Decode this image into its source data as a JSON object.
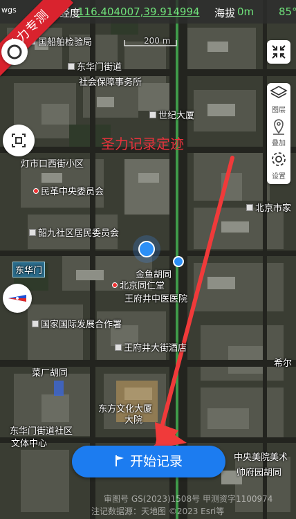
{
  "status": {
    "crs_label": "wgs",
    "coord_label": "经度",
    "coord_value": "116.404007,39.914994",
    "altitude_label": "海拔",
    "altitude_value": "0m",
    "temperature_value": "85°"
  },
  "ribbon": {
    "label": "圣力专测"
  },
  "watermark": {
    "text": "圣力记录定迹"
  },
  "scale": {
    "label": "200 m"
  },
  "toolbar": {
    "layers_label": "图层",
    "overlay_label": "叠加",
    "settings_label": "设置"
  },
  "icons": {
    "locate": "locate-icon",
    "fullscreen": "collapse-icon",
    "layers": "layers-icon",
    "overlay": "overlay-pin-icon",
    "settings": "gear-icon",
    "scan": "scan-icon",
    "compass": "compass-icon",
    "flag": "flag-icon"
  },
  "poi": {
    "p1": "国船舶检验局",
    "p2": "东华门街道",
    "p3": "社会保障事务所",
    "p4": "世纪大厦",
    "p5": "灯市口西街小区",
    "p6": "民革中央委员会",
    "p7": "北京市家",
    "p8": "韶九社区居民委员会",
    "p9": "东华门",
    "p10": "金鱼胡同",
    "p11": "北京同仁堂",
    "p12": "王府井中医医院",
    "p13": "国家国际发展合作署",
    "p14": "王府井大街酒店",
    "p15": "菜厂胡同",
    "p16": "东方文化大厦",
    "p17": "大院",
    "p18": "东华门街道社区",
    "p19": "文体中心",
    "p20": "中央美院美术",
    "p21": "帅府园胡同",
    "p22": "希尔"
  },
  "actions": {
    "start_record_label": "开始记录"
  },
  "attribution": {
    "line1": "审图号 GS(2023)1508号 甲测资字1100974",
    "line2": "注记数据源：天地图 ©2023 Esri等"
  },
  "colors": {
    "accent": "#1c7cf0",
    "ribbon": "#d9232e",
    "value_green": "#6fe07a",
    "arrow_red": "#f03a3a"
  }
}
